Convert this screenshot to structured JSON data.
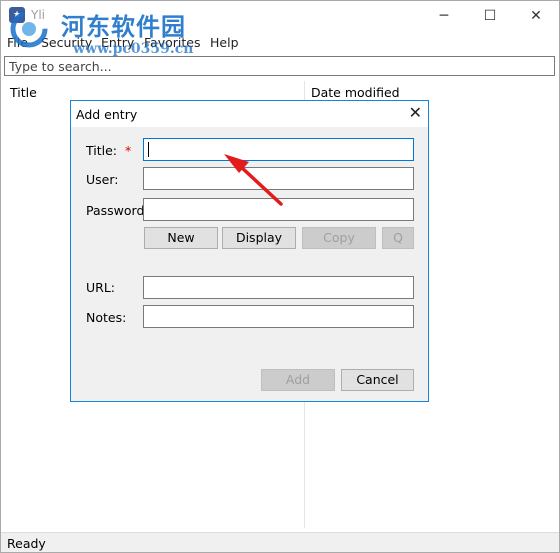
{
  "window": {
    "title": "Yli",
    "minimize": "─",
    "maximize": "☐",
    "close": "✕"
  },
  "watermark": {
    "text": "河东软件园",
    "url": "www.pc0359.cn"
  },
  "menu": {
    "items": [
      {
        "label": "File"
      },
      {
        "label": "Security"
      },
      {
        "label": "Entry"
      },
      {
        "label": "Favorites"
      },
      {
        "label": "Help"
      }
    ]
  },
  "search": {
    "placeholder": "Type to search...",
    "value": ""
  },
  "list": {
    "columns": [
      {
        "label": "Title"
      },
      {
        "label": "Date modified"
      }
    ]
  },
  "status": {
    "text": "Ready"
  },
  "dialog": {
    "title": "Add entry",
    "close": "✕",
    "labels": {
      "title": "Title:",
      "required": "*",
      "user": "User:",
      "password": "Password",
      "url": "URL:",
      "notes": "Notes:"
    },
    "values": {
      "title": "",
      "user": "",
      "password": "",
      "url": "",
      "notes": ""
    },
    "buttons": {
      "new": "New",
      "display": "Display",
      "copy": "Copy",
      "q": "Q",
      "add": "Add",
      "cancel": "Cancel"
    }
  },
  "colors": {
    "accent": "#0078d7",
    "dialog_border": "#1883d7",
    "required": "#d40000",
    "arrow": "#e31b1b",
    "watermark": "#1a72c9"
  }
}
